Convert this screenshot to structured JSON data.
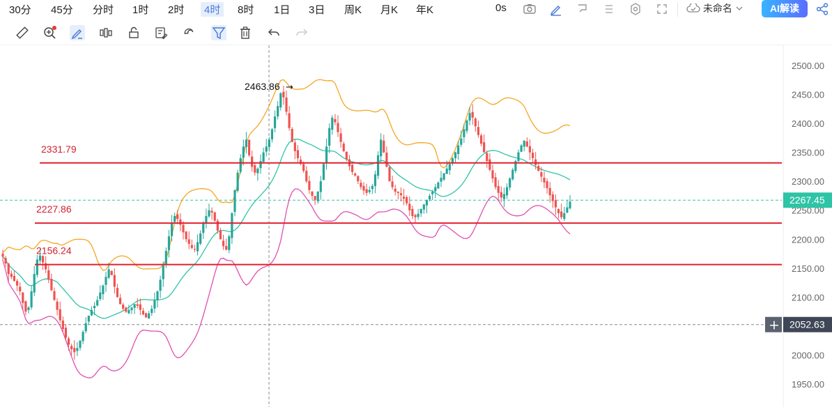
{
  "toolbar": {
    "timeframes": [
      "30分",
      "45分",
      "分时",
      "1时",
      "2时",
      "4时",
      "8时",
      "1日",
      "3日",
      "周K",
      "月K",
      "年K"
    ],
    "active_timeframe": "4时",
    "replay_label": "0s",
    "layout_name": "未命名",
    "ai_button_label": "AI解读"
  },
  "drawing_tools": [
    "ruler",
    "zoom-in",
    "brush",
    "bars-visibility",
    "lock",
    "edit-list",
    "magnet",
    "filter",
    "delete",
    "undo",
    "redo"
  ],
  "colors": {
    "up_candle": "#26a69a",
    "down_candle": "#ef5350",
    "upper_band": "#f5a623",
    "middle_band": "#2ec4a6",
    "lower_band": "#e04fb0",
    "horizontal_line": "#e0202f",
    "axis_text": "#666666",
    "accent": "#4a7bd8"
  },
  "chart_data": {
    "type": "candlestick",
    "y_axis_ticks": [
      "2500.00",
      "2450.00",
      "2400.00",
      "2350.00",
      "2300.00",
      "2250.00",
      "2200.00",
      "2150.00",
      "2100.00",
      "2050.00",
      "2000.00",
      "1950.00"
    ],
    "ylim": [
      1925,
      2520
    ],
    "grid": false,
    "high_marker": {
      "label": "2463.86",
      "value": 2463.86
    },
    "horizontal_lines": [
      {
        "label": "2331.79",
        "value": 2331.79
      },
      {
        "label": "2227.86",
        "value": 2227.86
      },
      {
        "label": "2156.24",
        "value": 2156.24
      }
    ],
    "current_price_label": "2267.45",
    "current_price": 2267.45,
    "crosshair_price_label": "2052.63",
    "crosshair_price": 2052.63,
    "closes": [
      2170,
      2158,
      2140,
      2135,
      2128,
      2120,
      2110,
      2090,
      2075,
      2082,
      2110,
      2140,
      2165,
      2172,
      2160,
      2148,
      2130,
      2112,
      2095,
      2078,
      2060,
      2045,
      2030,
      2018,
      2010,
      2005,
      2012,
      2025,
      2040,
      2055,
      2068,
      2078,
      2085,
      2095,
      2108,
      2120,
      2135,
      2148,
      2138,
      2118,
      2100,
      2088,
      2080,
      2075,
      2078,
      2082,
      2088,
      2085,
      2078,
      2070,
      2065,
      2072,
      2080,
      2095,
      2110,
      2130,
      2155,
      2180,
      2205,
      2228,
      2240,
      2235,
      2225,
      2212,
      2200,
      2192,
      2185,
      2182,
      2195,
      2210,
      2228,
      2240,
      2250,
      2246,
      2232,
      2215,
      2200,
      2188,
      2182,
      2205,
      2245,
      2285,
      2315,
      2340,
      2360,
      2372,
      2345,
      2325,
      2315,
      2322,
      2335,
      2350,
      2360,
      2372,
      2390,
      2412,
      2430,
      2452,
      2445,
      2420,
      2392,
      2368,
      2352,
      2340,
      2330,
      2318,
      2300,
      2285,
      2275,
      2268,
      2282,
      2300,
      2330,
      2360,
      2392,
      2410,
      2402,
      2385,
      2368,
      2352,
      2338,
      2326,
      2316,
      2310,
      2300,
      2290,
      2284,
      2280,
      2285,
      2292,
      2312,
      2345,
      2372,
      2350,
      2325,
      2300,
      2290,
      2282,
      2280,
      2276,
      2270,
      2262,
      2250,
      2240,
      2238,
      2244,
      2252,
      2260,
      2268,
      2275,
      2282,
      2290,
      2298,
      2306,
      2314,
      2322,
      2330,
      2340,
      2350,
      2362,
      2374,
      2390,
      2405,
      2418,
      2410,
      2395,
      2380,
      2365,
      2350,
      2335,
      2320,
      2305,
      2290,
      2280,
      2272,
      2278,
      2290,
      2305,
      2320,
      2335,
      2350,
      2362,
      2370,
      2360,
      2350,
      2340,
      2328,
      2318,
      2308,
      2298,
      2288,
      2276,
      2266,
      2255,
      2245,
      2238,
      2245,
      2255,
      2265
    ]
  }
}
